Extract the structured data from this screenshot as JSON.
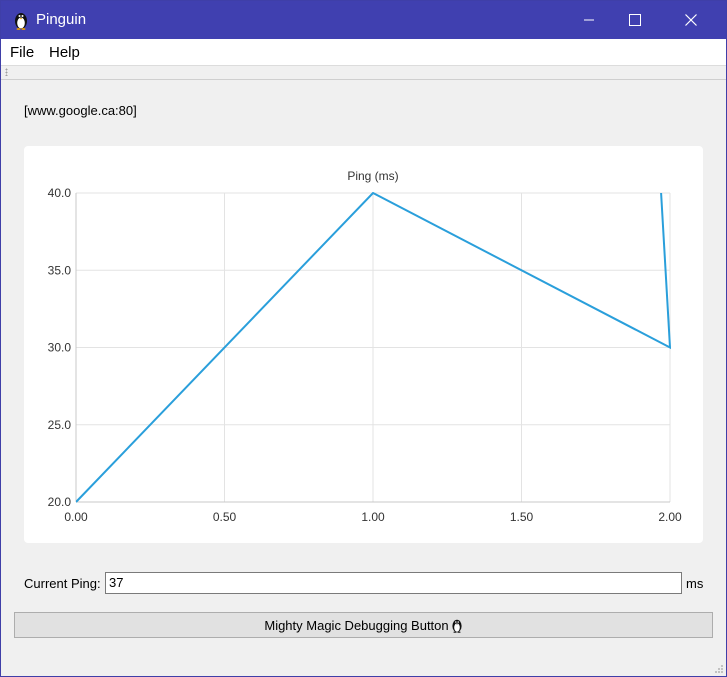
{
  "window": {
    "title": "Pinguin",
    "app_icon": "penguin-icon",
    "controls": [
      "minimize-icon",
      "maximize-icon",
      "close-icon"
    ]
  },
  "menu": {
    "items": [
      {
        "label": "File"
      },
      {
        "label": "Help"
      }
    ]
  },
  "host": {
    "label": "[www.google.ca:80]"
  },
  "chart_data": {
    "type": "line",
    "title": "Ping (ms)",
    "xlabel": "",
    "ylabel": "",
    "xlim": [
      0,
      2
    ],
    "ylim": [
      20,
      40
    ],
    "x_ticks": [
      "0.00",
      "0.50",
      "1.00",
      "1.50",
      "2.00"
    ],
    "y_ticks": [
      "20.0",
      "25.0",
      "30.0",
      "35.0",
      "40.0"
    ],
    "grid": true,
    "color": "#2a9fdb",
    "series": [
      {
        "x": [
          0,
          1,
          2,
          1.97
        ],
        "y": [
          20,
          40,
          30,
          40
        ]
      }
    ]
  },
  "current_ping": {
    "label": "Current Ping:",
    "value": "37",
    "unit": "ms"
  },
  "debug_button": {
    "label": "Mighty Magic Debugging Button",
    "icon": "penguin-icon"
  },
  "colors": {
    "titlebar": "#4040b0",
    "line": "#2a9fdb"
  }
}
